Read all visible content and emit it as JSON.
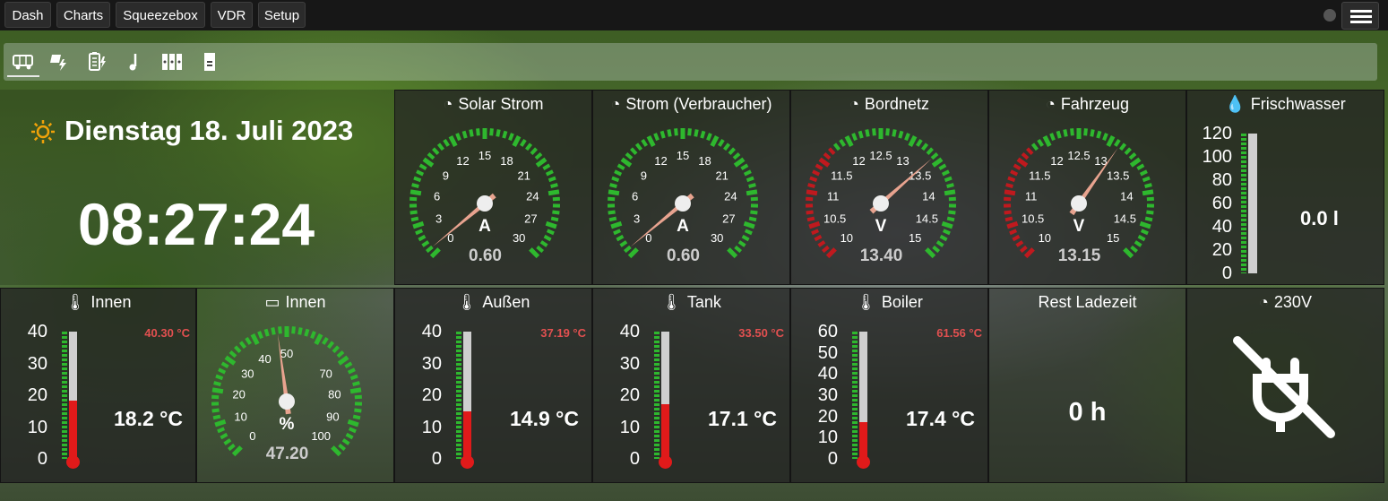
{
  "nav": {
    "items": [
      "Dash",
      "Charts",
      "Squeezebox",
      "VDR",
      "Setup"
    ]
  },
  "tabs": [
    {
      "icon": "bus-icon",
      "active": true
    },
    {
      "icon": "solar-panel-bolt-icon",
      "active": false
    },
    {
      "icon": "battery-charging-icon",
      "active": false
    },
    {
      "icon": "music-note-icon",
      "active": false
    },
    {
      "icon": "speaker-columns-icon",
      "active": false
    },
    {
      "icon": "sd-card-icon",
      "active": false
    }
  ],
  "clock": {
    "date": "Dienstag 18. Juli 2023",
    "time": "08:27:24"
  },
  "gauges": {
    "solar": {
      "title": "Solar Strom",
      "unit": "A",
      "value": "0.60",
      "ticks": [
        "0",
        "3",
        "6",
        "9",
        "12",
        "15",
        "18",
        "21",
        "24",
        "27",
        "30"
      ],
      "min": 0,
      "max": 30,
      "reading": 0.6
    },
    "consumer": {
      "title": "Strom (Verbraucher)",
      "unit": "A",
      "value": "0.60",
      "ticks": [
        "0",
        "3",
        "6",
        "9",
        "12",
        "15",
        "18",
        "21",
        "24",
        "27",
        "30"
      ],
      "min": 0,
      "max": 30,
      "reading": 0.6
    },
    "bordnetz": {
      "title": "Bordnetz",
      "unit": "V",
      "value": "13.40",
      "ticks": [
        "10",
        "10.5",
        "11",
        "11.5",
        "12",
        "12.5",
        "13",
        "13.5",
        "14",
        "14.5",
        "15"
      ],
      "min": 10,
      "max": 15,
      "reading": 13.4
    },
    "fahrzeug": {
      "title": "Fahrzeug",
      "unit": "V",
      "value": "13.15",
      "ticks": [
        "10",
        "10.5",
        "11",
        "11.5",
        "12",
        "12.5",
        "13",
        "13.5",
        "14",
        "14.5",
        "15"
      ],
      "min": 10,
      "max": 15,
      "reading": 13.15
    },
    "humidity": {
      "title": "Innen",
      "unit": "%",
      "value": "47.20",
      "ticks": [
        "0",
        "10",
        "20",
        "30",
        "40",
        "50",
        "70",
        "80",
        "90",
        "100"
      ],
      "min": 0,
      "max": 100,
      "reading": 47.2
    }
  },
  "tank": {
    "title": "Frischwasser",
    "value": "0.0 l",
    "scale": [
      "120",
      "100",
      "80",
      "60",
      "40",
      "20",
      "0"
    ],
    "fill": 0
  },
  "temps": {
    "innen": {
      "title": "Innen",
      "value": "18.2 °C",
      "max": "40.30 °C",
      "scale": [
        "40",
        "30",
        "20",
        "10",
        "0"
      ],
      "fill": 0.455
    },
    "aussen": {
      "title": "Außen",
      "value": "14.9 °C",
      "max": "37.19 °C",
      "scale": [
        "40",
        "30",
        "20",
        "10",
        "0"
      ],
      "fill": 0.3725
    },
    "tank": {
      "title": "Tank",
      "value": "17.1 °C",
      "max": "33.50 °C",
      "scale": [
        "40",
        "30",
        "20",
        "10",
        "0"
      ],
      "fill": 0.4275
    },
    "boiler": {
      "title": "Boiler",
      "value": "17.4 °C",
      "max": "61.56 °C",
      "scale": [
        "60",
        "50",
        "40",
        "30",
        "20",
        "10",
        "0"
      ],
      "fill": 0.29
    }
  },
  "rest": {
    "title": "Rest Ladezeit",
    "value": "0 h"
  },
  "power": {
    "title": "230V",
    "icon": "power-plug-off-icon"
  },
  "colors": {
    "green": "#2eb82e",
    "red": "#c0191e",
    "needle": "#e8a38f",
    "max": "#e25050"
  }
}
